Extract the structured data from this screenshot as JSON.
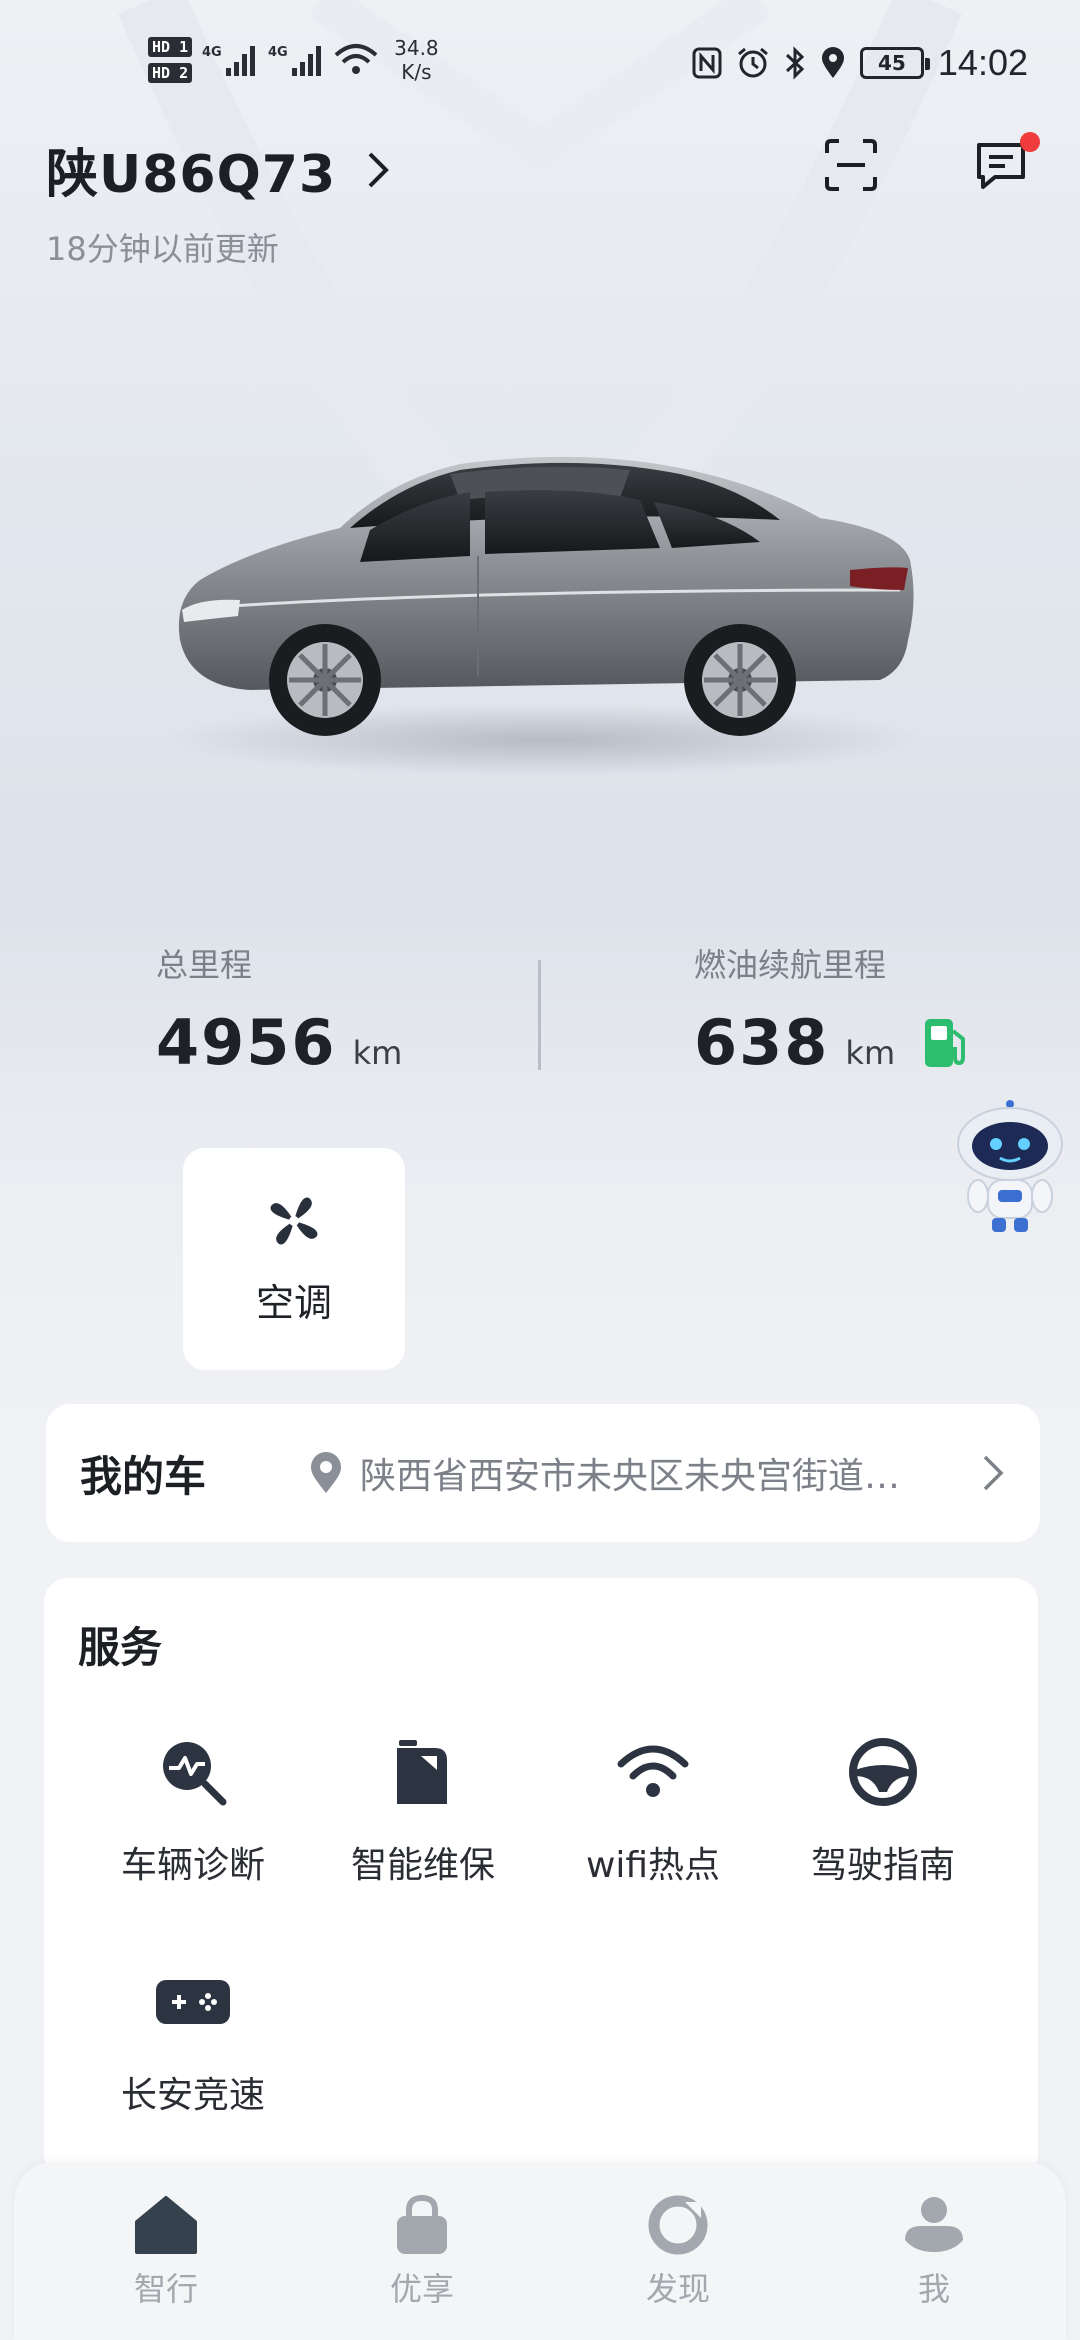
{
  "status_bar": {
    "hd1": "HD 1",
    "hd2": "HD 2",
    "net1": "4G",
    "net2": "4G",
    "speed_value": "34.8",
    "speed_unit": "K/s",
    "battery": "45",
    "time": "14:02",
    "icons": [
      "nfc-icon",
      "alarm-icon",
      "bluetooth-icon",
      "location-icon"
    ]
  },
  "header": {
    "plate": "陕U86Q73",
    "updated": "18分钟以前更新",
    "icons": [
      "scan-icon",
      "message-icon"
    ]
  },
  "stats": {
    "total_label": "总里程",
    "total_value": "4956",
    "total_unit": "km",
    "range_label": "燃油续航里程",
    "range_value": "638",
    "range_unit": "km",
    "fuel_color": "#2dbd6e"
  },
  "quick_controls": {
    "ac_label": "空调"
  },
  "my_car": {
    "title": "我的车",
    "location": "陕西省西安市未央区未央宫街道…"
  },
  "services": {
    "title": "服务",
    "items": [
      {
        "label": "车辆诊断",
        "icon": "diagnosis-icon"
      },
      {
        "label": "智能维保",
        "icon": "maintenance-icon"
      },
      {
        "label": "wifi热点",
        "icon": "wifi-icon"
      },
      {
        "label": "驾驶指南",
        "icon": "steering-wheel-icon"
      },
      {
        "label": "长安竞速",
        "icon": "gamepad-icon"
      }
    ]
  },
  "bottom_nav": {
    "items": [
      {
        "label": "智行",
        "icon": "home-icon"
      },
      {
        "label": "优享",
        "icon": "bag-icon"
      },
      {
        "label": "发现",
        "icon": "discover-icon"
      },
      {
        "label": "我",
        "icon": "profile-icon"
      }
    ]
  },
  "colors": {
    "accent_green": "#2dbd6e",
    "badge_red": "#f03c3c",
    "icon_dark": "#2b3440",
    "nav_inactive": "#a3a7ae",
    "nav_active_icon": "#36414e"
  }
}
